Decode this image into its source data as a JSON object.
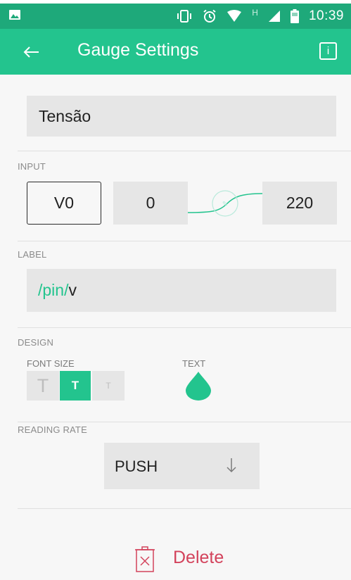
{
  "status_bar": {
    "time": "10:39",
    "network_mark": "H",
    "icons": [
      "image-notification-icon",
      "vibrate-icon",
      "alarm-icon",
      "wifi-icon",
      "signal-icon",
      "battery-icon"
    ]
  },
  "app_bar": {
    "title": "Gauge Settings",
    "info_label": "i",
    "back_icon": "back-arrow-icon"
  },
  "name_field": {
    "value": "Tensão"
  },
  "input": {
    "section_label": "INPUT",
    "pin": "V0",
    "min": "0",
    "max": "220"
  },
  "label": {
    "section_label": "LABEL",
    "prefix": "/pin/",
    "suffix": "v"
  },
  "design": {
    "section_label": "DESIGN",
    "font_size_label": "FONT SIZE",
    "text_label": "TEXT",
    "font_size_options": [
      "T",
      "T",
      "T"
    ],
    "selected_font_size_index": 1,
    "text_color": "#23c48e"
  },
  "reading_rate": {
    "section_label": "READING RATE",
    "value": "PUSH"
  },
  "delete": {
    "label": "Delete",
    "color": "#d3435c"
  },
  "colors": {
    "accent": "#23c48e",
    "status_bar": "#1ea97a",
    "delete": "#d3435c"
  }
}
